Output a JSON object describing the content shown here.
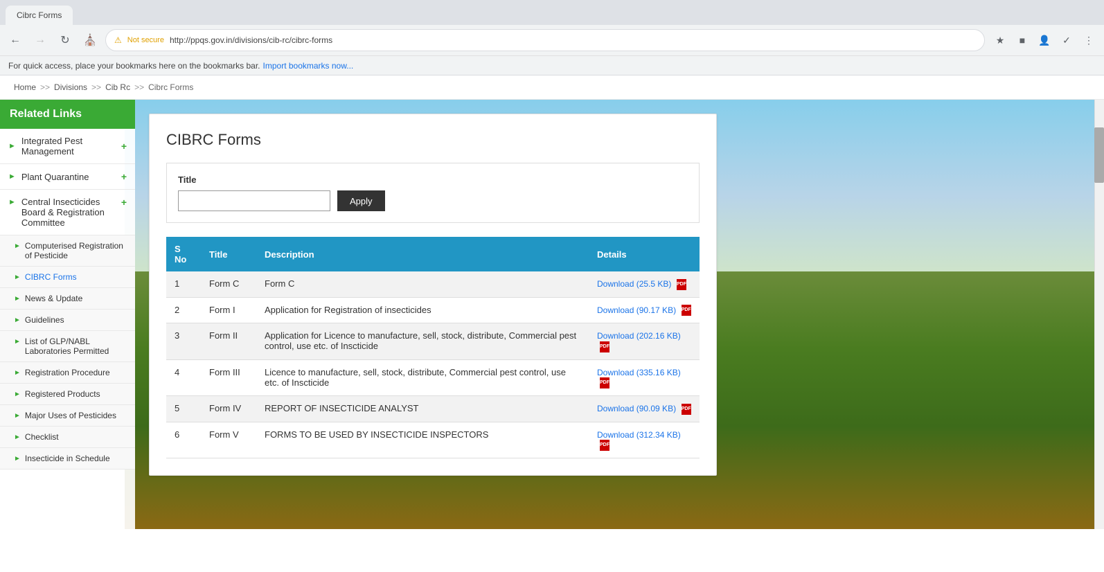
{
  "browser": {
    "tab_title": "Cibrc Forms",
    "nav": {
      "back_disabled": false,
      "forward_disabled": true,
      "reload_title": "Reload",
      "home_title": "Home"
    },
    "address_bar": {
      "security_label": "Not secure",
      "url": "http://ppqs.gov.in/divisions/cib-rc/cibrc-forms"
    },
    "bookmarks_bar_text": "For quick access, place your bookmarks here on the bookmarks bar.",
    "bookmarks_import_label": "Import bookmarks now..."
  },
  "breadcrumb": {
    "items": [
      "Home",
      "Divisions",
      "Cib Rc",
      "Cibrc Forms"
    ],
    "separators": [
      ">>",
      ">>",
      ">>"
    ]
  },
  "sidebar": {
    "header": "Related Links",
    "top_links": [
      {
        "label": "Integrated Pest Management",
        "has_plus": true
      },
      {
        "label": "Plant Quarantine",
        "has_plus": true
      },
      {
        "label": "Central Insecticides Board & Registration Committee",
        "has_plus": true
      }
    ],
    "sub_links": [
      {
        "label": "Computerised Registration of Pesticide"
      },
      {
        "label": "CIBRC Forms",
        "active": true
      },
      {
        "label": "News & Update"
      },
      {
        "label": "Guidelines"
      },
      {
        "label": "List of GLP/NABL Laboratories Permitted"
      },
      {
        "label": "Registration Procedure"
      },
      {
        "label": "Registered Products"
      },
      {
        "label": "Major Uses of Pesticides"
      },
      {
        "label": "Checklist"
      },
      {
        "label": "Insecticide in Schedule"
      }
    ]
  },
  "content": {
    "page_title": "CIBRC Forms",
    "filter": {
      "label": "Title",
      "input_placeholder": "",
      "apply_button": "Apply"
    },
    "table": {
      "headers": [
        "S No",
        "Title",
        "Description",
        "Details"
      ],
      "rows": [
        {
          "sno": "1",
          "title": "Form C",
          "description": "Form C",
          "download_label": "Download (25.5 KB)"
        },
        {
          "sno": "2",
          "title": "Form I",
          "description": "Application for Registration of insecticides",
          "download_label": "Download (90.17 KB)"
        },
        {
          "sno": "3",
          "title": "Form II",
          "description": "Application for Licence to manufacture, sell, stock, distribute, Commercial pest control, use etc. of Inscticide",
          "download_label": "Download (202.16 KB)"
        },
        {
          "sno": "4",
          "title": "Form III",
          "description": "Licence to manufacture, sell, stock, distribute, Commercial pest control, use etc. of Inscticide",
          "download_label": "Download (335.16 KB)"
        },
        {
          "sno": "5",
          "title": "Form IV",
          "description": "REPORT OF INSECTICIDE ANALYST",
          "download_label": "Download (90.09 KB)"
        },
        {
          "sno": "6",
          "title": "Form V",
          "description": "FORMS TO BE USED BY INSECTICIDE INSPECTORS",
          "download_label": "Download (312.34 KB)"
        }
      ]
    }
  }
}
